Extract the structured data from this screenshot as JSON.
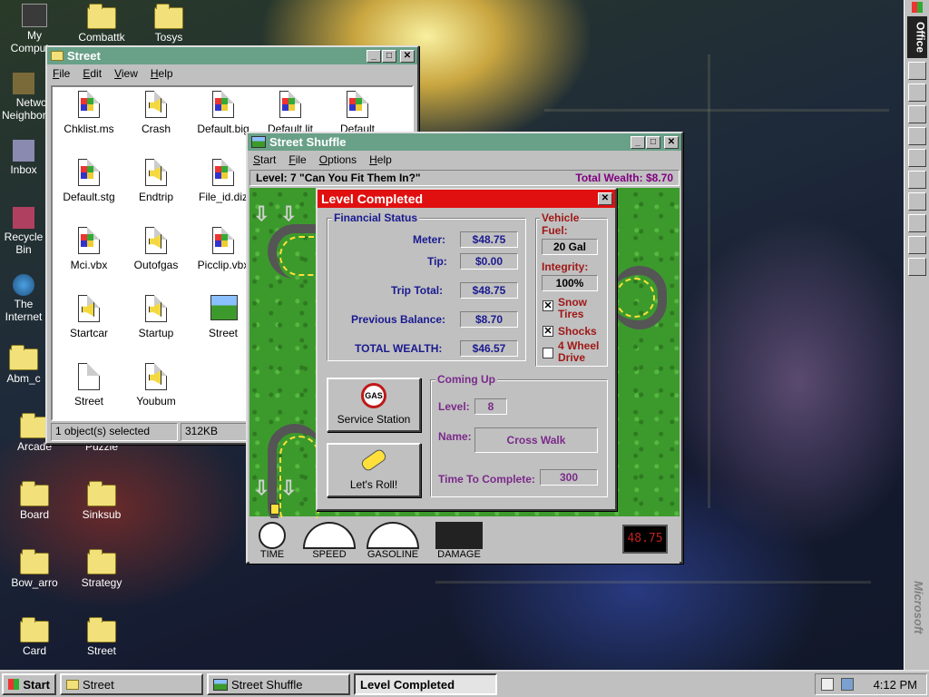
{
  "desktop": {
    "icons": [
      {
        "label": "My Computer"
      },
      {
        "label": "Combattk"
      },
      {
        "label": "Tosys"
      },
      {
        "label": "Network Neighborhood"
      },
      {
        "label": "Inbox"
      },
      {
        "label": "Recycle Bin"
      },
      {
        "label": "The Internet"
      },
      {
        "label": "Abm_c"
      },
      {
        "label": "Arcade"
      },
      {
        "label": "Puzzle"
      },
      {
        "label": "Board"
      },
      {
        "label": "Sinksub"
      },
      {
        "label": "Bow_arro"
      },
      {
        "label": "Strategy"
      },
      {
        "label": "Card"
      },
      {
        "label": "Street"
      }
    ]
  },
  "explorer": {
    "title": "Street",
    "menu": [
      "File",
      "Edit",
      "View",
      "Help"
    ],
    "files": [
      {
        "name": "Chklist.ms",
        "icon": "windows-file-icon"
      },
      {
        "name": "Crash",
        "icon": "sound-file-icon"
      },
      {
        "name": "Default.big",
        "icon": "windows-file-icon"
      },
      {
        "name": "Default.lit",
        "icon": "windows-file-icon"
      },
      {
        "name": "Default",
        "icon": "windows-file-icon"
      },
      {
        "name": "Default.stg",
        "icon": "windows-file-icon"
      },
      {
        "name": "Endtrip",
        "icon": "sound-file-icon"
      },
      {
        "name": "File_id.diz",
        "icon": "windows-file-icon"
      },
      {
        "name": "Mci.vbx",
        "icon": "windows-file-icon"
      },
      {
        "name": "Outofgas",
        "icon": "sound-file-icon"
      },
      {
        "name": "Picclip.vbx",
        "icon": "windows-file-icon"
      },
      {
        "name": "Startcar",
        "icon": "sound-file-icon"
      },
      {
        "name": "Startup",
        "icon": "sound-file-icon"
      },
      {
        "name": "Street",
        "icon": "street-app-icon"
      },
      {
        "name": "Street",
        "icon": "text-file-icon"
      },
      {
        "name": "Youbum",
        "icon": "sound-file-icon"
      }
    ],
    "status_selected": "1 object(s) selected",
    "status_size": "312KB"
  },
  "game": {
    "title": "Street Shuffle",
    "menu": [
      "Start",
      "File",
      "Options",
      "Help"
    ],
    "level_text": "Level: 7  \"Can You Fit Them In?\"",
    "wealth_text": "Total Wealth: $8.70",
    "gauges": [
      "TIME",
      "SPEED",
      "GASOLINE",
      "DAMAGE"
    ],
    "digital_readout": "48.75",
    "colors": {
      "grass": "#3c9a2c",
      "road": "#555555",
      "road_line": "#ffe03a"
    }
  },
  "dialog": {
    "title": "Level Completed",
    "financial": {
      "label": "Financial Status",
      "meter_label": "Meter:",
      "meter": "$48.75",
      "tip_label": "Tip:",
      "tip": "$0.00",
      "trip_label": "Trip Total:",
      "trip": "$48.75",
      "prev_label": "Previous Balance:",
      "prev": "$8.70",
      "total_label": "TOTAL WEALTH:",
      "total": "$46.57"
    },
    "vehicle": {
      "label": "Vehicle",
      "fuel_label": "Fuel:",
      "fuel": "20 Gal",
      "integrity_label": "Integrity:",
      "integrity": "100%",
      "snow_tires": "Snow Tires",
      "snow_checked": "✕",
      "shocks": "Shocks",
      "shocks_checked": "✕",
      "four_wheel": "4 Wheel Drive",
      "four_checked": ""
    },
    "service_button": "Service Station",
    "gas_logo": "GAS",
    "roll_button": "Let's Roll!",
    "coming_up": {
      "label": "Coming Up",
      "level_label": "Level:",
      "level": "8",
      "name_label": "Name:",
      "name": "Cross Walk",
      "time_label": "Time To Complete:",
      "time": "300"
    }
  },
  "officebar": {
    "brand": "Office",
    "footer": "Microsoft"
  },
  "taskbar": {
    "start": "Start",
    "tasks": [
      {
        "label": "Street",
        "active": false
      },
      {
        "label": "Street Shuffle",
        "active": false
      },
      {
        "label": "Level Completed",
        "active": true
      }
    ],
    "clock": "4:12 PM"
  }
}
